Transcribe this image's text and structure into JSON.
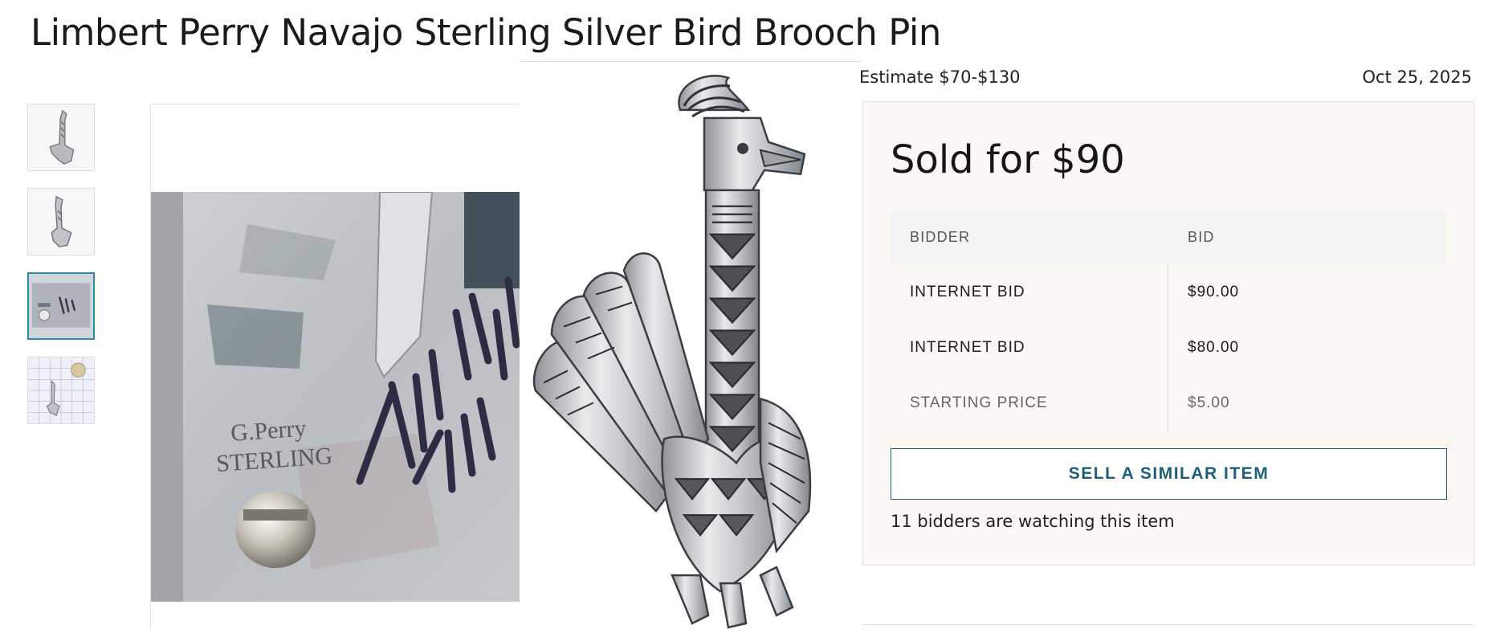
{
  "listing": {
    "title": "Limbert Perry Navajo Sterling Silver Bird Brooch Pin",
    "estimate": "Estimate $70-$130",
    "date": "Oct 25, 2025"
  },
  "sale": {
    "sold_text": "Sold for $90",
    "table_headers": {
      "bidder": "BIDDER",
      "bid": "BID"
    },
    "bids": [
      {
        "bidder": "INTERNET BID",
        "amount": "$90.00"
      },
      {
        "bidder": "INTERNET BID",
        "amount": "$80.00"
      },
      {
        "bidder": "STARTING PRICE",
        "amount": "$5.00"
      }
    ],
    "sell_button": "SELL A SIMILAR ITEM",
    "watching_text": "11 bidders are watching this item"
  },
  "gallery": {
    "thumbnails": [
      "bird-pin-front",
      "bird-pin-angle",
      "hallmark-closeup",
      "pin-on-ruler-grid"
    ],
    "active_thumbnail": 2
  },
  "colors": {
    "accent": "#1d5f7a",
    "thumb_active": "#2a8ca8",
    "panel_bg": "#fbf7f3"
  }
}
